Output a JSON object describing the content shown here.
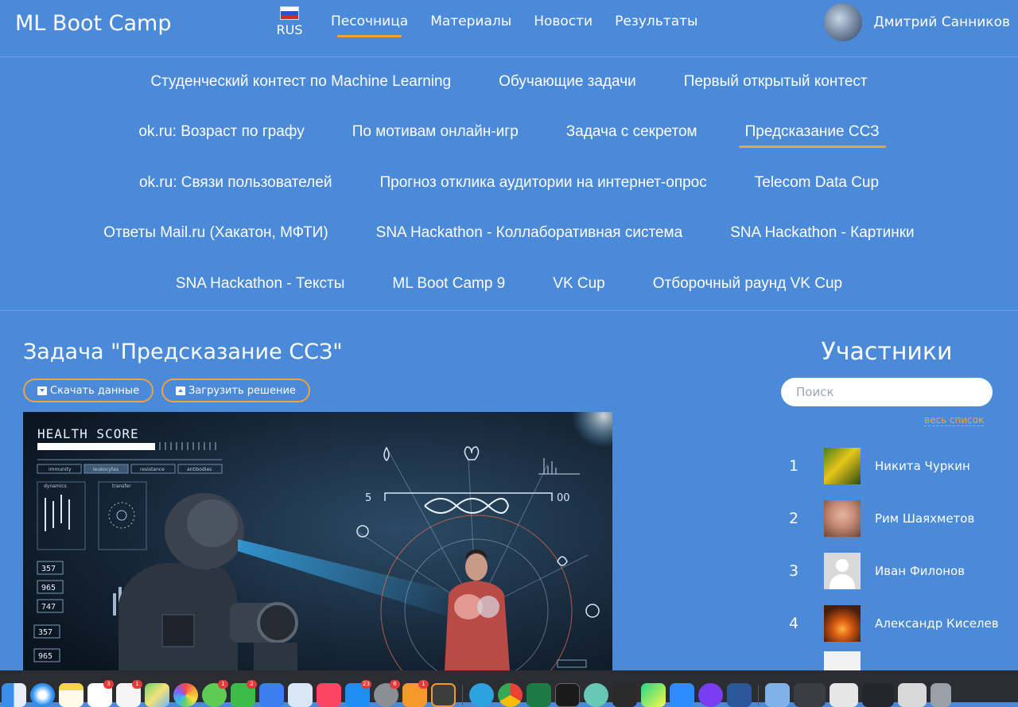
{
  "header": {
    "logo": "ML Boot Camp",
    "lang": "RUS",
    "flag_colors": [
      "#ffffff",
      "#2a55c0",
      "#d52b1e"
    ],
    "nav": [
      {
        "label": "Песочница",
        "active": true
      },
      {
        "label": "Материалы",
        "active": false
      },
      {
        "label": "Новости",
        "active": false
      },
      {
        "label": "Результаты",
        "active": false
      }
    ],
    "user_name": "Дмитрий Санников"
  },
  "contests": {
    "rows": [
      [
        "Студенческий контест по Machine Learning",
        "Обучающие задачи",
        "Первый открытый контест"
      ],
      [
        "ok.ru: Возраст по графу",
        "По мотивам онлайн-игр",
        "Задача с секретом",
        "Предсказание ССЗ"
      ],
      [
        "ok.ru: Связи пользователей",
        "Прогноз отклика аудитории на интернет-опрос",
        "Telecom Data Cup"
      ],
      [
        "Ответы Mail.ru (Хакатон, МФТИ)",
        "SNA Hackathon - Коллаборативная система",
        "SNA Hackathon - Картинки"
      ],
      [
        "SNA Hackathon - Тексты",
        "ML Boot Camp 9",
        "VK Cup",
        "Отборочный раунд VK Cup"
      ]
    ],
    "active": "Предсказание ССЗ"
  },
  "task": {
    "title": "Задача \"Предсказание ССЗ\"",
    "download_label": "Скачать данные",
    "upload_label": "Загрузить решение",
    "hero": {
      "health_score": "HEALTH SCORE",
      "tabs": [
        "immunity",
        "leukocytes",
        "resistance",
        "antibodies"
      ],
      "subtabs": [
        "dynamics",
        "transfer"
      ],
      "readouts": [
        "357",
        "965",
        "747",
        "357",
        "965"
      ],
      "scale_left": "5",
      "scale_right": "00"
    }
  },
  "participants": {
    "title": "Участники",
    "search_placeholder": "Поиск",
    "all_list": "весь список",
    "list": [
      {
        "rank": "1",
        "name": "Никита Чуркин"
      },
      {
        "rank": "2",
        "name": "Рим Шаяхметов"
      },
      {
        "rank": "3",
        "name": "Иван Филонов"
      },
      {
        "rank": "4",
        "name": "Александр Киселев"
      }
    ]
  },
  "dock": {
    "badges": [
      "3",
      "1",
      "1",
      "2",
      "23",
      "6",
      "1"
    ]
  },
  "colors": {
    "background": "#4a8ad9",
    "accent": "#f5a03a",
    "text": "#ffffff"
  }
}
